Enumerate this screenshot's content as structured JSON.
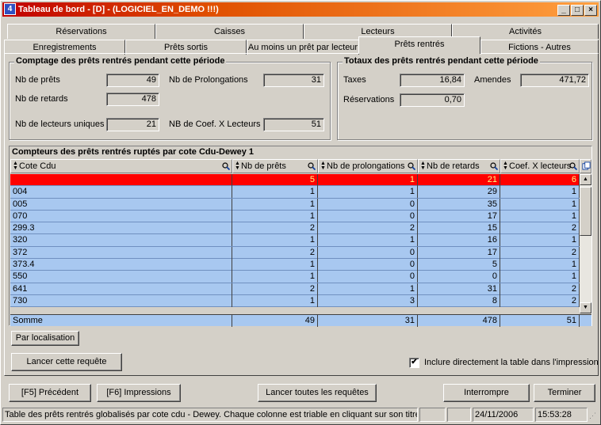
{
  "window": {
    "title": "Tableau de bord  - [D] - (LOGICIEL_EN_DEMO !!!)",
    "icon": "app-icon"
  },
  "tabs_row1": [
    "Réservations",
    "Caisses",
    "Lecteurs",
    "Activités"
  ],
  "tabs_row2": [
    "Enregistrements",
    "Prêts sortis",
    "Au moins un prêt par lecteur",
    "Prêts rentrés",
    "Fictions - Autres"
  ],
  "active_tab": "Prêts rentrés",
  "comptage": {
    "title": "Comptage des prêts rentrés pendant cette période",
    "nb_prets_label": "Nb de prêts",
    "nb_prets": "49",
    "nb_prolong_label": "Nb de Prolongations",
    "nb_prolong": "31",
    "nb_retards_label": "Nb de retards",
    "nb_retards": "478",
    "nb_lecteurs_label": "Nb de lecteurs uniques",
    "nb_lecteurs": "21",
    "nb_coef_label": "NB de Coef. X Lecteurs",
    "nb_coef": "51"
  },
  "totaux": {
    "title": "Totaux des prêts rentrés pendant cette période",
    "taxes_label": "Taxes",
    "taxes": "16,84",
    "amendes_label": "Amendes",
    "amendes": "471,72",
    "reservations_label": "Réservations",
    "reservations": "0,70"
  },
  "table": {
    "title": "Compteurs des prêts rentrés ruptés par cote Cdu-Dewey 1",
    "columns": [
      "Cote Cdu",
      "Nb de prêts",
      "Nb de prolongations",
      "Nb de retards",
      "Coef. X lecteurs"
    ],
    "rows": [
      [
        "",
        "5",
        "1",
        "21",
        "6"
      ],
      [
        "004",
        "1",
        "1",
        "29",
        "1"
      ],
      [
        "005",
        "1",
        "0",
        "35",
        "1"
      ],
      [
        "070",
        "1",
        "0",
        "17",
        "1"
      ],
      [
        "299.3",
        "2",
        "2",
        "15",
        "2"
      ],
      [
        "320",
        "1",
        "1",
        "16",
        "1"
      ],
      [
        "372",
        "2",
        "0",
        "17",
        "2"
      ],
      [
        "373.4",
        "1",
        "0",
        "5",
        "1"
      ],
      [
        "550",
        "1",
        "0",
        "0",
        "1"
      ],
      [
        "641",
        "2",
        "1",
        "31",
        "2"
      ],
      [
        "730",
        "1",
        "3",
        "8",
        "2"
      ]
    ],
    "sum": [
      "Somme",
      "49",
      "31",
      "478",
      "51"
    ]
  },
  "buttons": {
    "par_localisation": "Par localisation",
    "lancer_requete": "Lancer cette requête",
    "inclure_label": "Inclure directement la table dans l'impression",
    "precedent": "[F5] Précédent",
    "impressions": "[F6] Impressions",
    "lancer_toutes": "Lancer toutes les requêtes",
    "interrompre": "Interrompre",
    "terminer": "Terminer"
  },
  "inclure_checked": true,
  "status": {
    "message": "Table des prêts rentrés globalisés par cote cdu - Dewey. Chaque colonne est triable en cliquant sur son titre",
    "date": "24/11/2006",
    "time": "15:53:28"
  }
}
